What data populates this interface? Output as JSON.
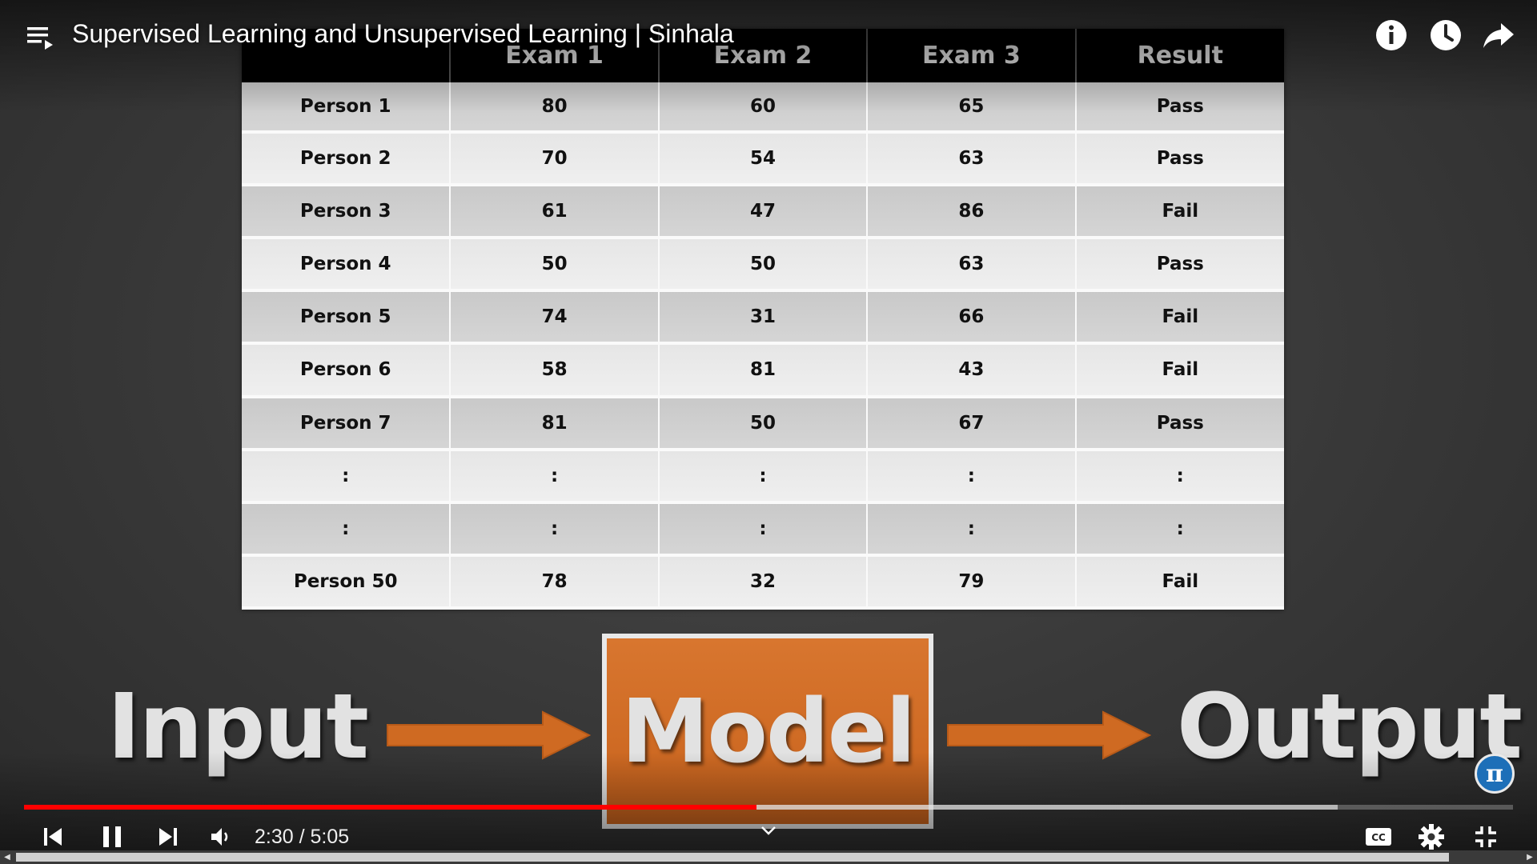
{
  "video": {
    "title": "Supervised Learning and Unsupervised Learning | Sinhala",
    "time_display": "2:30 / 5:05",
    "progress_played": 0.4919,
    "progress_buffered": 0.8825
  },
  "slide": {
    "table": {
      "headers": [
        "",
        "Exam 1",
        "Exam 2",
        "Exam 3",
        "Result"
      ],
      "rows": [
        [
          "Person 1",
          "80",
          "60",
          "65",
          "Pass"
        ],
        [
          "Person 2",
          "70",
          "54",
          "63",
          "Pass"
        ],
        [
          "Person 3",
          "61",
          "47",
          "86",
          "Fail"
        ],
        [
          "Person 4",
          "50",
          "50",
          "63",
          "Pass"
        ],
        [
          "Person 5",
          "74",
          "31",
          "66",
          "Fail"
        ],
        [
          "Person 6",
          "58",
          "81",
          "43",
          "Fail"
        ],
        [
          "Person 7",
          "81",
          "50",
          "67",
          "Pass"
        ],
        [
          ":",
          ":",
          ":",
          ":",
          ":"
        ],
        [
          ":",
          ":",
          ":",
          ":",
          ":"
        ],
        [
          "Person 50",
          "78",
          "32",
          "79",
          "Fail"
        ]
      ]
    },
    "diagram": {
      "input_label": "Input",
      "model_label": "Model",
      "output_label": "Output"
    }
  },
  "badge": {
    "symbol": "π"
  },
  "colors": {
    "progress_red": "#ff0000",
    "model_orange": "#d06a24",
    "arrow_orange": "#cf6a22",
    "badge_blue": "#1d6fb8"
  },
  "icons": [
    "playlist-icon",
    "info-icon",
    "watch-later-icon",
    "share-icon",
    "skip-previous-icon",
    "pause-icon",
    "skip-next-icon",
    "volume-icon",
    "captions-icon",
    "settings-icon",
    "exit-fullscreen-icon",
    "chevron-down-icon"
  ]
}
